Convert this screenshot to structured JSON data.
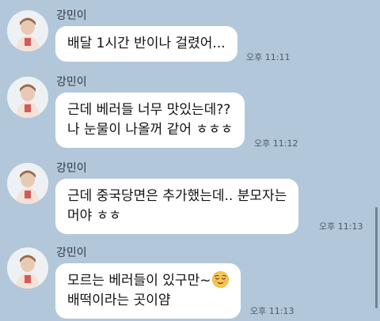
{
  "messages": [
    {
      "sender": "강민이",
      "lines": [
        "배달 1시간 반이나 걸렸어..."
      ],
      "time": "오후 11:11"
    },
    {
      "sender": "강민이",
      "lines": [
        "근데 베러들 너무 맛있는데??",
        "나 눈물이 나올꺼 같어 ㅎㅎㅎ"
      ],
      "time": "오후 11:12"
    },
    {
      "sender": "강민이",
      "lines": [
        "근데 중국당면은 추가했는데.. 분모자는",
        "머야 ㅎㅎ"
      ],
      "time": "오후 11:13"
    },
    {
      "sender": "강민이",
      "lines": [
        "모르는 베러들이 있구만~",
        "배떡이라는 곳이얌"
      ],
      "time": "오후 11:13",
      "emoji": "relieved-face"
    }
  ],
  "colors": {
    "background": "#b2c7d9",
    "bubble": "#ffffff",
    "time_text": "#4b5b69"
  }
}
